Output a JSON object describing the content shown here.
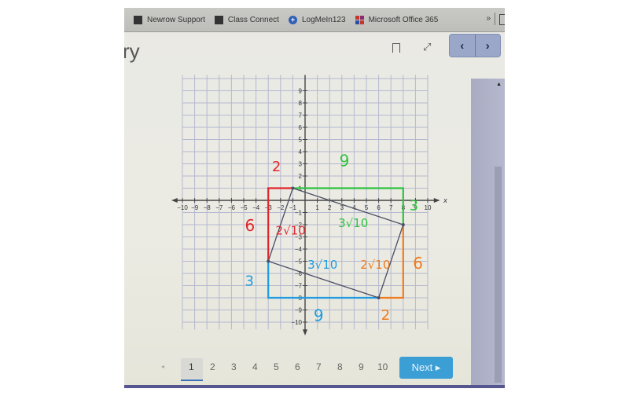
{
  "bookmarks_bar": {
    "items": [
      {
        "label": "Newrow Support",
        "icon": "square-dark-icon"
      },
      {
        "label": "Class Connect",
        "icon": "square-dark-icon"
      },
      {
        "label": "LogMeIn123",
        "icon": "plus-circle-icon"
      },
      {
        "label": "Microsoft Office 365",
        "icon": "office-grid-icon"
      }
    ],
    "overflow_label": "»"
  },
  "header": {
    "title_fragment": "ry",
    "bookmark_icon": "bookmark-icon",
    "expand_icon": "expand-icon",
    "prev_label": "‹",
    "next_label": "›"
  },
  "graph": {
    "x_axis_label": "x",
    "x_range": [
      -10,
      10
    ],
    "y_range": [
      -10,
      9
    ],
    "x_ticks": [
      "-10",
      "-9",
      "-8",
      "-7",
      "-6",
      "-5",
      "-4",
      "-3",
      "-2",
      "-1",
      "1",
      "2",
      "3",
      "4",
      "5",
      "6",
      "7",
      "8",
      "9",
      "10"
    ],
    "y_ticks": [
      "9",
      "8",
      "7",
      "6",
      "5",
      "4",
      "3",
      "2",
      "1",
      "-1",
      "-2",
      "-3",
      "-4",
      "-5",
      "-6",
      "-7",
      "-8",
      "-9",
      "-10"
    ],
    "quadrilateral": [
      [
        -1,
        1
      ],
      [
        8,
        -2
      ],
      [
        6,
        -8
      ],
      [
        -3,
        -5
      ]
    ],
    "annotation_boxes": [
      {
        "color": "#e0262b",
        "corners": [
          [
            -3,
            1
          ],
          [
            -1,
            1
          ],
          [
            -3,
            -5
          ]
        ],
        "labels": [
          "2",
          "6",
          "2√10"
        ]
      },
      {
        "color": "#2fc240",
        "corners": [
          [
            -1,
            1
          ],
          [
            8,
            1
          ],
          [
            8,
            -2
          ]
        ],
        "labels": [
          "9",
          "3",
          "3√10"
        ]
      },
      {
        "color": "#f07a1e",
        "corners": [
          [
            8,
            -2
          ],
          [
            8,
            -8
          ],
          [
            6,
            -8
          ]
        ],
        "labels": [
          "6",
          "2",
          "2√10"
        ]
      },
      {
        "color": "#1f9be0",
        "corners": [
          [
            -3,
            -5
          ],
          [
            -3,
            -8
          ],
          [
            6,
            -8
          ]
        ],
        "labels": [
          "3",
          "9",
          "3√10"
        ]
      }
    ]
  },
  "pagination": {
    "prev_label": "◂",
    "pages": [
      "1",
      "2",
      "3",
      "4",
      "5",
      "6",
      "7",
      "8",
      "9",
      "10"
    ],
    "current_page": "1",
    "next_label": "Next ▸"
  }
}
